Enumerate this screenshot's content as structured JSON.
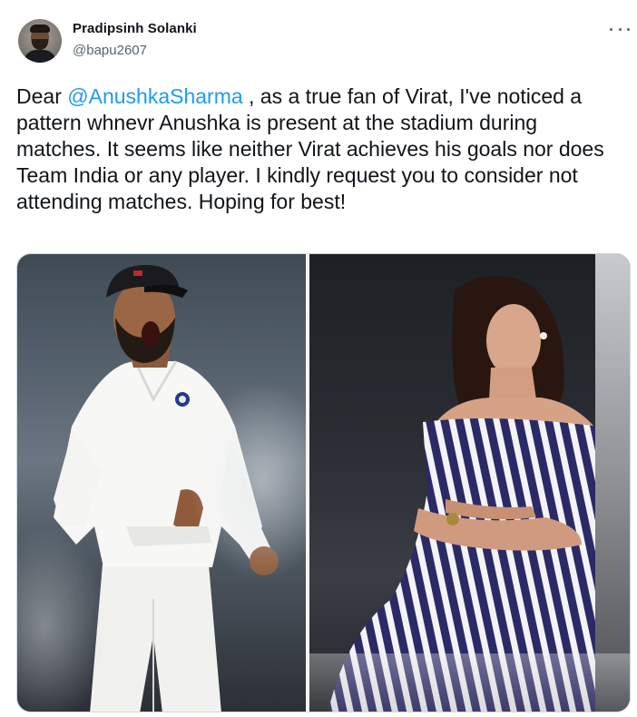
{
  "author": {
    "name": "Pradipsinh Solanki",
    "handle": "@bapu2607"
  },
  "tweet": {
    "text_before_mention": "Dear ",
    "mention": "@AnushkaSharma",
    "text_after_mention": " , as a true fan of Virat, I've noticed a pattern whnevr Anushka is present at the stadium during matches. It seems like neither Virat achieves his goals nor does Team India or any player. I kindly request you to consider not attending matches. Hoping for best!"
  },
  "icons": {
    "more": "more-horizontal-icon",
    "avatar": "profile-avatar"
  },
  "colors": {
    "link": "#1d9bf0",
    "text": "#0f1419",
    "secondary": "#536471",
    "border": "#cfd9de"
  }
}
